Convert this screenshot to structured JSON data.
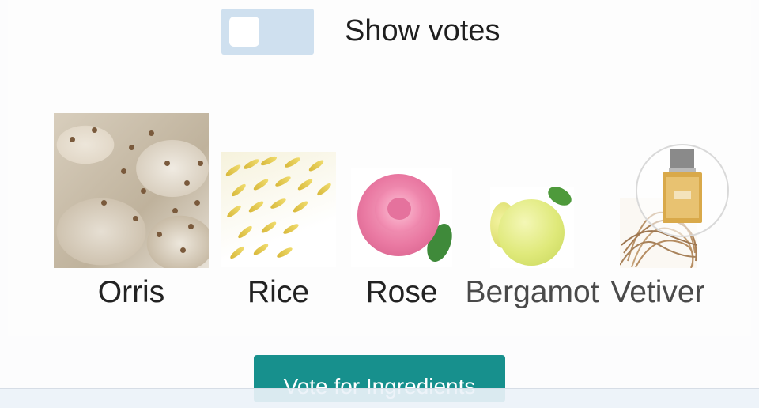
{
  "toggle": {
    "label": "Show votes",
    "on": false
  },
  "ingredients": [
    {
      "name": "Orris",
      "image": "orris-root-image"
    },
    {
      "name": "Rice",
      "image": "rice-grains-image"
    },
    {
      "name": "Rose",
      "image": "pink-rose-image"
    },
    {
      "name": "Bergamot",
      "image": "bergamot-fruit-image"
    },
    {
      "name": "Vetiver",
      "image": "vetiver-roots-image"
    }
  ],
  "vote_button": {
    "label": "Vote for Ingredients"
  },
  "colors": {
    "toggle_track": "#cfe0ef",
    "vote_button": "#17908d"
  }
}
